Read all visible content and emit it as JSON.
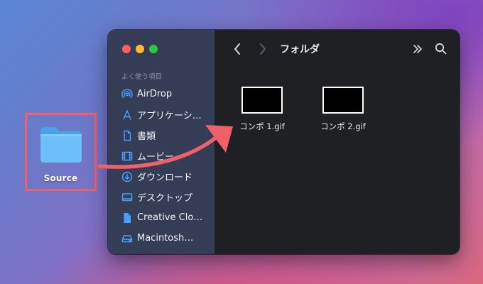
{
  "desktop": {
    "folder_label": "Source"
  },
  "window": {
    "title": "フォルダ",
    "sidebar": {
      "section_label": "よく使う項目",
      "items": [
        {
          "label": "AirDrop",
          "icon": "airdrop-icon"
        },
        {
          "label": "アプリケーシ…",
          "icon": "applications-icon"
        },
        {
          "label": "書類",
          "icon": "document-icon"
        },
        {
          "label": "ムービー",
          "icon": "movie-icon"
        },
        {
          "label": "ダウンロード",
          "icon": "download-icon"
        },
        {
          "label": "デスクトップ",
          "icon": "desktop-icon"
        },
        {
          "label": "Creative Clo…",
          "icon": "file-icon"
        },
        {
          "label": "Macintosh…",
          "icon": "disk-icon"
        }
      ]
    },
    "files": [
      {
        "name": "コンポ 1.gif"
      },
      {
        "name": "コンポ 2.gif"
      }
    ]
  },
  "colors": {
    "highlight_border": "#f0606a",
    "arrow": "#f0606a",
    "sidebar_bg": "#353c56",
    "main_bg": "#1f2024",
    "icon_blue": "#4aa0ff"
  }
}
